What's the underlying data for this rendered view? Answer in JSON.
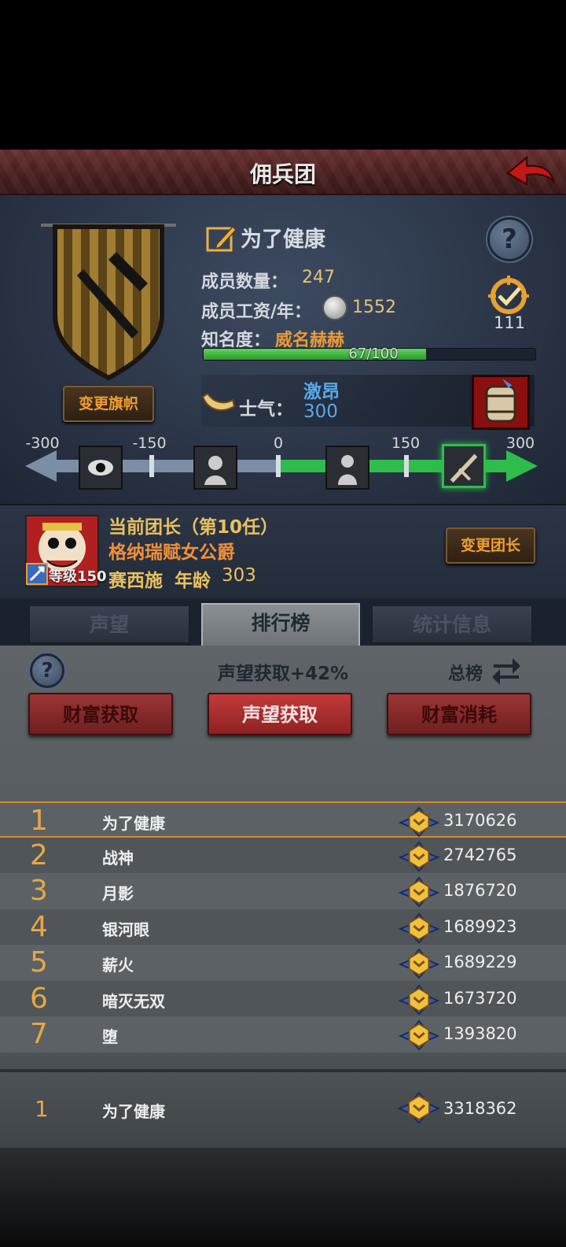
{
  "title": "佣兵团",
  "guild": {
    "name": "为了健康",
    "members_label": "成员数量：",
    "members_value": "247",
    "salary_label": "成员工资/年：",
    "salary_value": "1552",
    "fame_label": "知名度：",
    "fame_rank": "威名赫赫",
    "fame_progress": "67/100",
    "fame_fraction": 0.67,
    "target_count": "111",
    "change_flag": "变更旗帜"
  },
  "morale": {
    "label": "士气：",
    "state": "激昂",
    "value": "300",
    "scale_ticks": [
      "-300",
      "-150",
      "0",
      "150",
      "300"
    ]
  },
  "leader": {
    "title": "当前团长（第10任）",
    "noble_title": "格纳瑞赋女公爵",
    "name": "赛西施",
    "age_label": "年龄",
    "age": "303",
    "level_label": "等级",
    "level": "150",
    "change_leader": "变更团长"
  },
  "tabs": [
    "声望",
    "排行榜",
    "统计信息"
  ],
  "ranking": {
    "subtitle": "声望获取+42%",
    "total_label": "总榜",
    "categories": [
      "财富获取",
      "声望获取",
      "财富消耗"
    ],
    "rows": [
      {
        "rank": "1",
        "name": "为了健康",
        "score": "3170626"
      },
      {
        "rank": "2",
        "name": "战神",
        "score": "2742765"
      },
      {
        "rank": "3",
        "name": "月影",
        "score": "1876720"
      },
      {
        "rank": "4",
        "name": "银河眼",
        "score": "1689923"
      },
      {
        "rank": "5",
        "name": "薪火",
        "score": "1689229"
      },
      {
        "rank": "6",
        "name": "暗灭无双",
        "score": "1673720"
      },
      {
        "rank": "7",
        "name": "堕",
        "score": "1393820"
      }
    ],
    "mine": {
      "rank": "1",
      "name": "为了健康",
      "score": "3318362"
    }
  },
  "colors": {
    "accent": "#e8a742",
    "morale_positive": "#2ebd4a",
    "fame_fill": "#3fb33f"
  }
}
